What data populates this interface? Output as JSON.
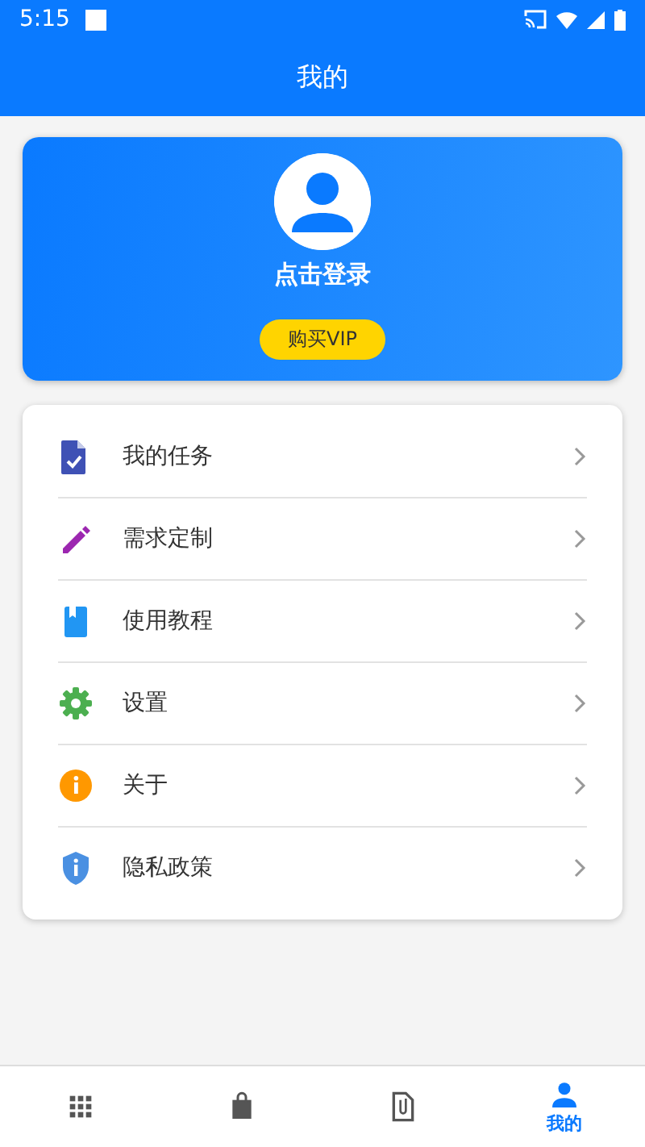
{
  "status_bar": {
    "time": "5:15"
  },
  "app_bar": {
    "title": "我的"
  },
  "profile": {
    "login": "点击登录",
    "vip_button": "购买VIP"
  },
  "menu": [
    {
      "kind": "task",
      "label": "我的任务",
      "color": "#3f51b5"
    },
    {
      "kind": "edit",
      "label": "需求定制",
      "color": "#9c27b0"
    },
    {
      "kind": "book",
      "label": "使用教程",
      "color": "#2196f3"
    },
    {
      "kind": "settings",
      "label": "设置",
      "color": "#4caf50"
    },
    {
      "kind": "info",
      "label": "关于",
      "color": "#ff9800"
    },
    {
      "kind": "shield",
      "label": "隐私政策",
      "color": "#4a90e2"
    }
  ],
  "bottom_nav": [
    {
      "kind": "grid",
      "selected": false
    },
    {
      "kind": "bag",
      "selected": false
    },
    {
      "kind": "file",
      "selected": false
    },
    {
      "kind": "person",
      "label": "我的",
      "selected": true
    }
  ]
}
